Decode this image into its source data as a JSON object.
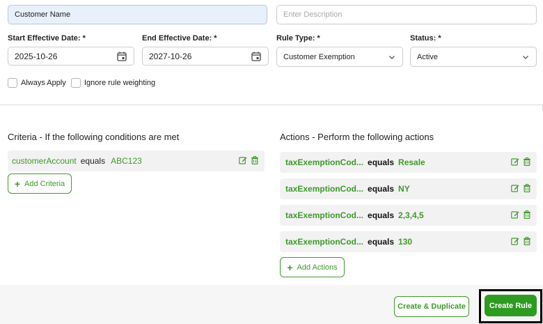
{
  "form": {
    "name": {
      "value": "Customer Name"
    },
    "description": {
      "placeholder": "Enter Description"
    },
    "start_date": {
      "label": "Start Effective Date: *",
      "value": "2025-10-26"
    },
    "end_date": {
      "label": "End Effective Date: *",
      "value": "2027-10-26"
    },
    "rule_type": {
      "label": "Rule Type: *",
      "value": "Customer Exemption"
    },
    "status": {
      "label": "Status: *",
      "value": "Active"
    },
    "always_apply": {
      "label": "Always Apply",
      "checked": false
    },
    "ignore_weighting": {
      "label": "Ignore rule weighting",
      "checked": false
    }
  },
  "criteria": {
    "title": "Criteria - If the following conditions are met",
    "rows": [
      {
        "field": "customerAccount",
        "op": "equals",
        "value": "ABC123"
      }
    ],
    "add_label": "Add Criteria"
  },
  "actions": {
    "title": "Actions - Perform the following actions",
    "rows": [
      {
        "field": "taxExemptionCod...",
        "op": "equals",
        "value": "Resale"
      },
      {
        "field": "taxExemptionCod...",
        "op": "equals",
        "value": "NY"
      },
      {
        "field": "taxExemptionCod...",
        "op": "equals",
        "value": "2,3,4,5"
      },
      {
        "field": "taxExemptionCod...",
        "op": "equals",
        "value": "130"
      }
    ],
    "add_label": "Add Actions"
  },
  "footer": {
    "duplicate_label": "Create & Duplicate",
    "create_label": "Create Rule"
  },
  "colors": {
    "accent_green": "#3f9a2c",
    "primary_button": "#2f9a22",
    "name_field_bg": "#e8f0fc"
  }
}
